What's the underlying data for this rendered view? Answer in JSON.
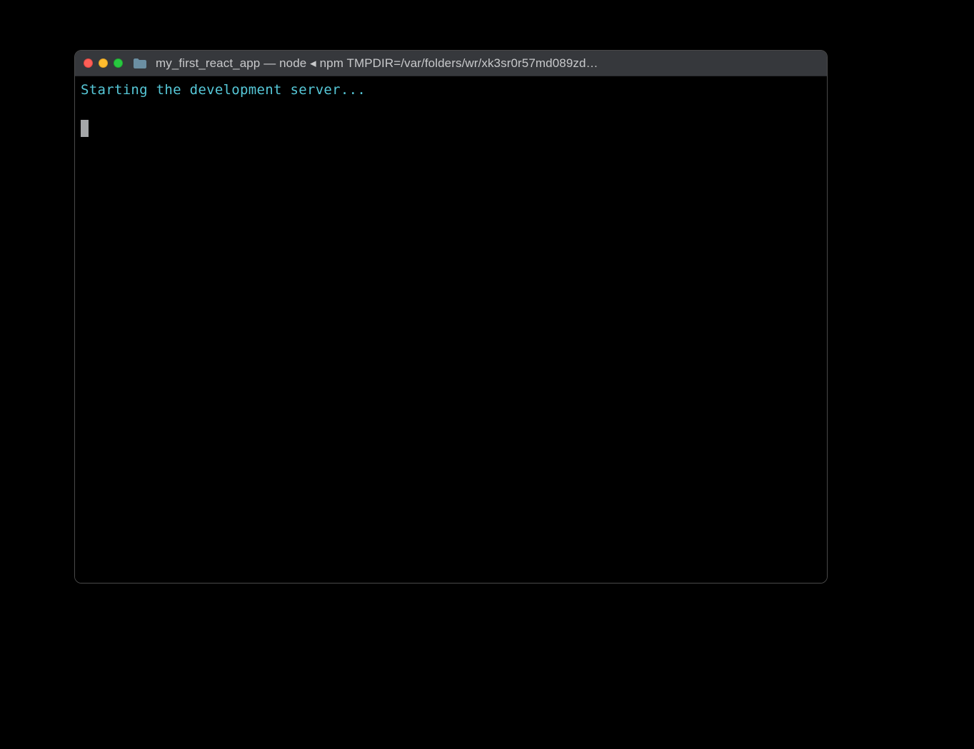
{
  "window": {
    "title": "my_first_react_app — node ◂ npm TMPDIR=/var/folders/wr/xk3sr0r57md089zd…"
  },
  "terminal": {
    "lines": [
      "Starting the development server..."
    ]
  }
}
